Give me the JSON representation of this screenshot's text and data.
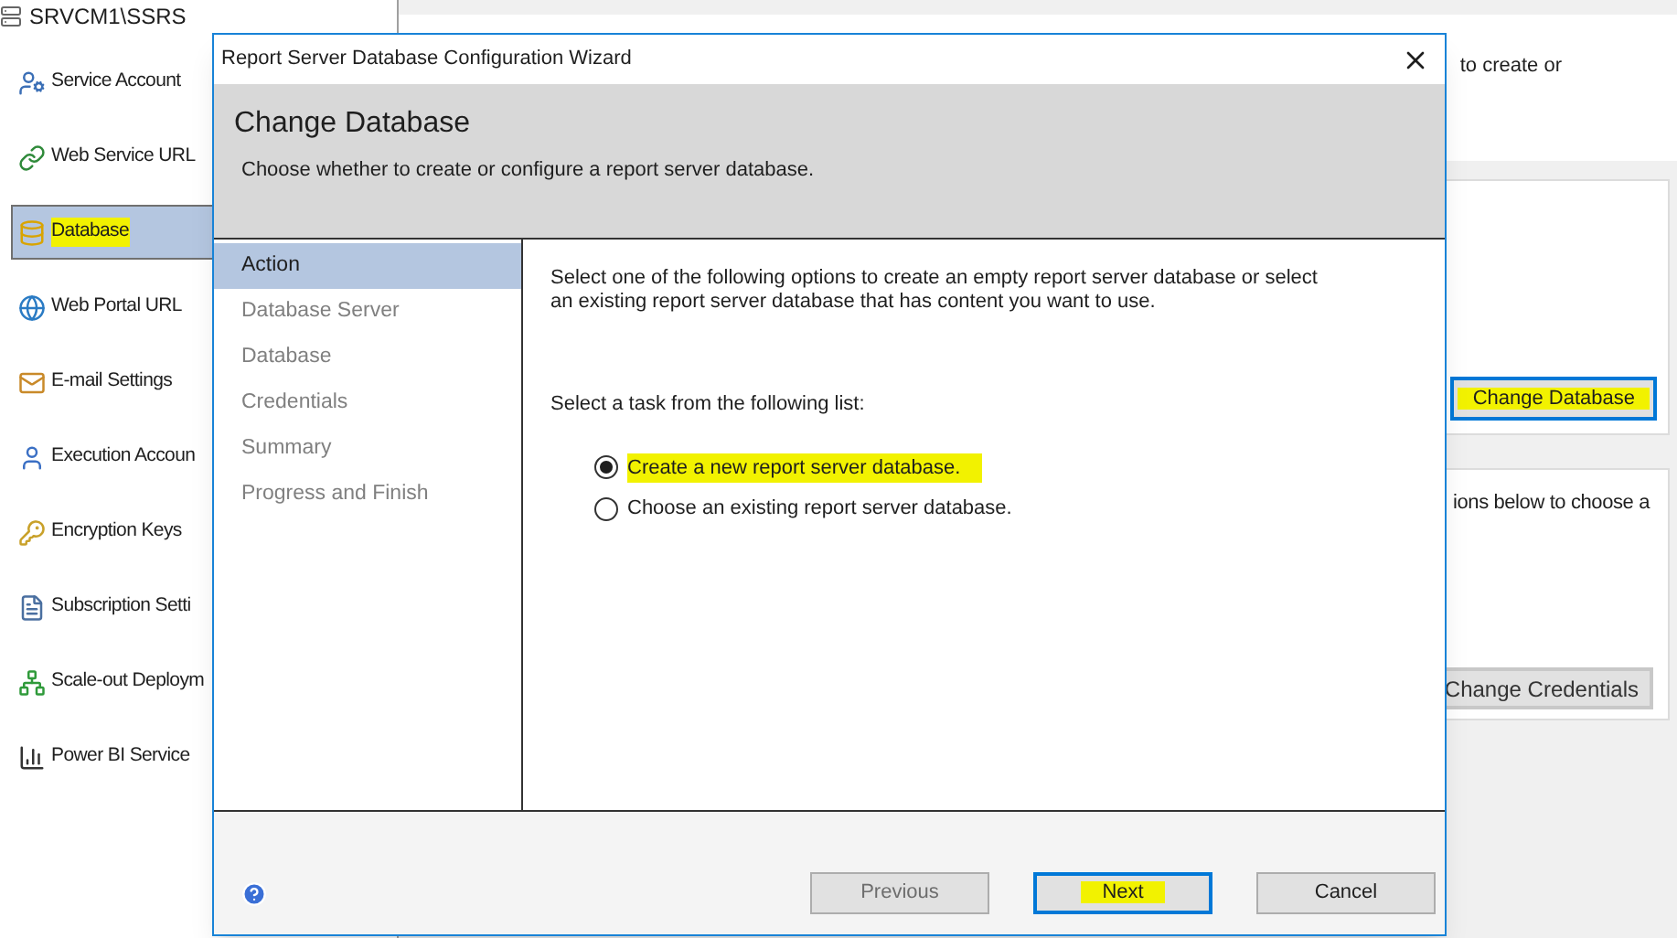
{
  "server": {
    "title": "SRVCM1\\SSRS"
  },
  "sidebar": {
    "items": [
      {
        "label": "Service Account",
        "kind": "account",
        "selected": false,
        "highlighted": false
      },
      {
        "label": "Web Service URL",
        "kind": "webservice",
        "selected": false,
        "highlighted": false
      },
      {
        "label": "Database",
        "kind": "database",
        "selected": true,
        "highlighted": true
      },
      {
        "label": "Web Portal URL",
        "kind": "globe",
        "selected": false,
        "highlighted": false
      },
      {
        "label": "E-mail Settings",
        "kind": "mail",
        "selected": false,
        "highlighted": false
      },
      {
        "label": "Execution Accoun",
        "kind": "user",
        "selected": false,
        "highlighted": false
      },
      {
        "label": "Encryption Keys",
        "kind": "keys",
        "selected": false,
        "highlighted": false
      },
      {
        "label": "Subscription Setti",
        "kind": "subscription",
        "selected": false,
        "highlighted": false
      },
      {
        "label": "Scale-out Deploym",
        "kind": "network",
        "selected": false,
        "highlighted": false
      },
      {
        "label": "Power BI Service",
        "kind": "chart",
        "selected": false,
        "highlighted": false
      }
    ]
  },
  "content": {
    "intro_fragment": "to create or",
    "database_panel": {
      "button": {
        "label": "Change Database",
        "highlighted": true
      }
    },
    "credentials_panel": {
      "text_fragment": "ions below to choose a",
      "button": {
        "label": "Change Credentials",
        "highlighted": false
      }
    }
  },
  "dialog": {
    "title": "Report Server Database Configuration Wizard",
    "heading": "Change Database",
    "subheading": "Choose whether to create or configure a report server database.",
    "steps": [
      {
        "label": "Action",
        "selected": true
      },
      {
        "label": "Database Server",
        "selected": false
      },
      {
        "label": "Database",
        "selected": false
      },
      {
        "label": "Credentials",
        "selected": false
      },
      {
        "label": "Summary",
        "selected": false
      },
      {
        "label": "Progress and Finish",
        "selected": false
      }
    ],
    "description": "Select one of the following options to create an empty report server database or select an existing report server database that has content you want to use.",
    "task_prompt": "Select a task from the following list:",
    "options": [
      {
        "label": "Create a new report server database.",
        "selected": true,
        "highlighted": true
      },
      {
        "label": "Choose an existing report server database.",
        "selected": false,
        "highlighted": false
      }
    ],
    "buttons": [
      {
        "label": "Previous",
        "disabled": true,
        "default": false,
        "highlighted": false
      },
      {
        "label": "Next",
        "disabled": false,
        "default": true,
        "highlighted": true
      },
      {
        "label": "Cancel",
        "disabled": false,
        "default": false,
        "highlighted": false
      }
    ]
  }
}
